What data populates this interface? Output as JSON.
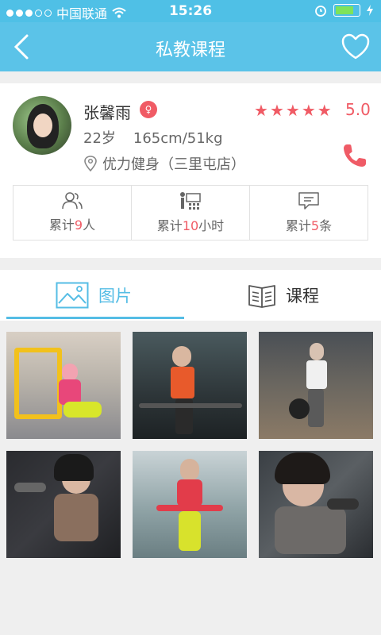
{
  "status": {
    "carrier": "中国联通",
    "time": "15:26"
  },
  "navbar": {
    "title": "私教课程"
  },
  "trainer": {
    "name": "张馨雨",
    "badge": "♀",
    "rating": "5.0",
    "age": "22岁",
    "height_weight": "165cm/51kg",
    "location": "优力健身（三里屯店）"
  },
  "stats": [
    {
      "prefix": "累计",
      "value": "9",
      "suffix": "人"
    },
    {
      "prefix": "累计",
      "value": "10",
      "suffix": "小时"
    },
    {
      "prefix": "累计",
      "value": "5",
      "suffix": "条"
    }
  ],
  "tabs": [
    {
      "label": "图片",
      "active": true
    },
    {
      "label": "课程",
      "active": false
    }
  ],
  "colors": {
    "accent": "#5bc3e8",
    "red": "#f05b65"
  }
}
